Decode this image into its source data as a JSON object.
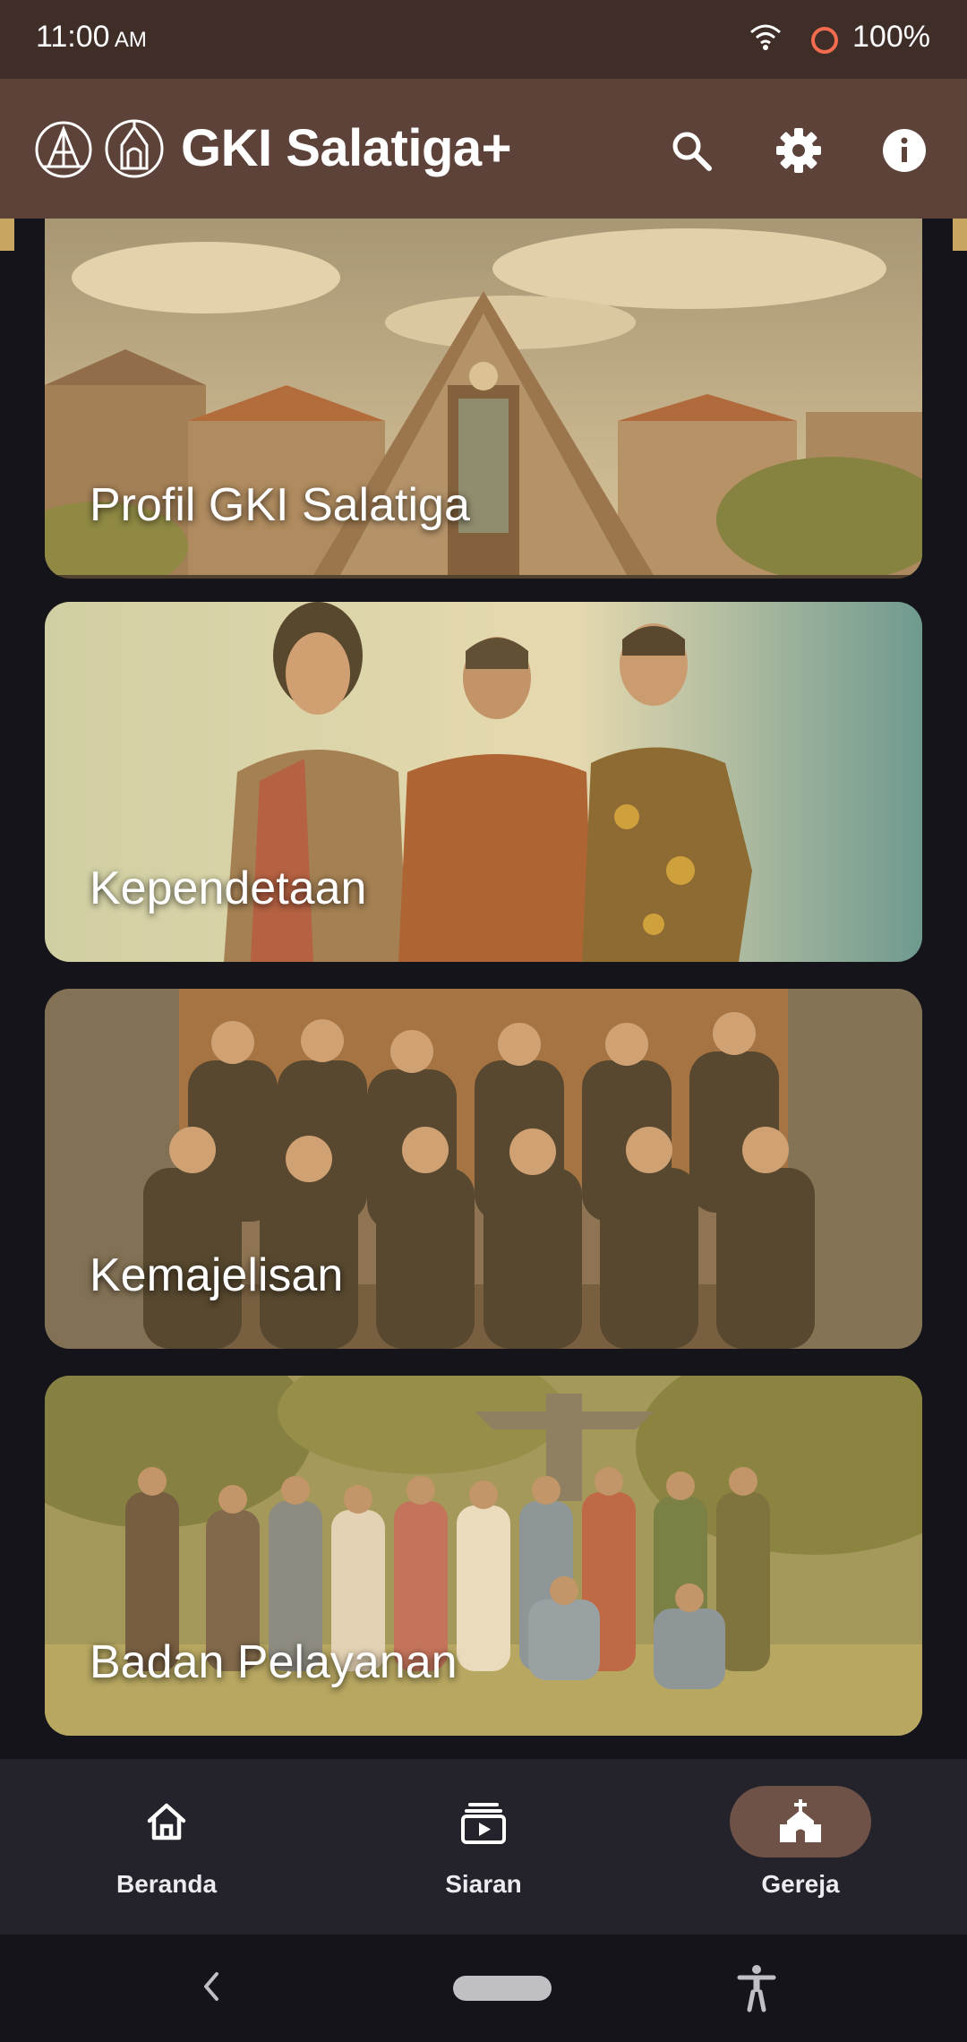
{
  "status_bar": {
    "time": "11:00",
    "ampm": "AM",
    "battery": "100%"
  },
  "app_bar": {
    "title": "GKI Salatiga+",
    "icons": [
      "search-icon",
      "gear-icon",
      "info-icon"
    ]
  },
  "cards": [
    {
      "label": "Profil GKI Salatiga"
    },
    {
      "label": "Kependetaan"
    },
    {
      "label": "Kemajelisan"
    },
    {
      "label": "Badan Pelayanan"
    }
  ],
  "bottom_nav": {
    "items": [
      {
        "label": "Beranda",
        "icon": "home-icon",
        "active": false
      },
      {
        "label": "Siaran",
        "icon": "broadcast-icon",
        "active": false
      },
      {
        "label": "Gereja",
        "icon": "church-icon",
        "active": true
      }
    ]
  },
  "colors": {
    "status_bar": "#3f2e28",
    "app_bar": "#5c4239",
    "background": "#15141a",
    "nav_bar": "#24222b",
    "nav_active_pill": "#6e5247",
    "card_tint": "#e0b260"
  }
}
